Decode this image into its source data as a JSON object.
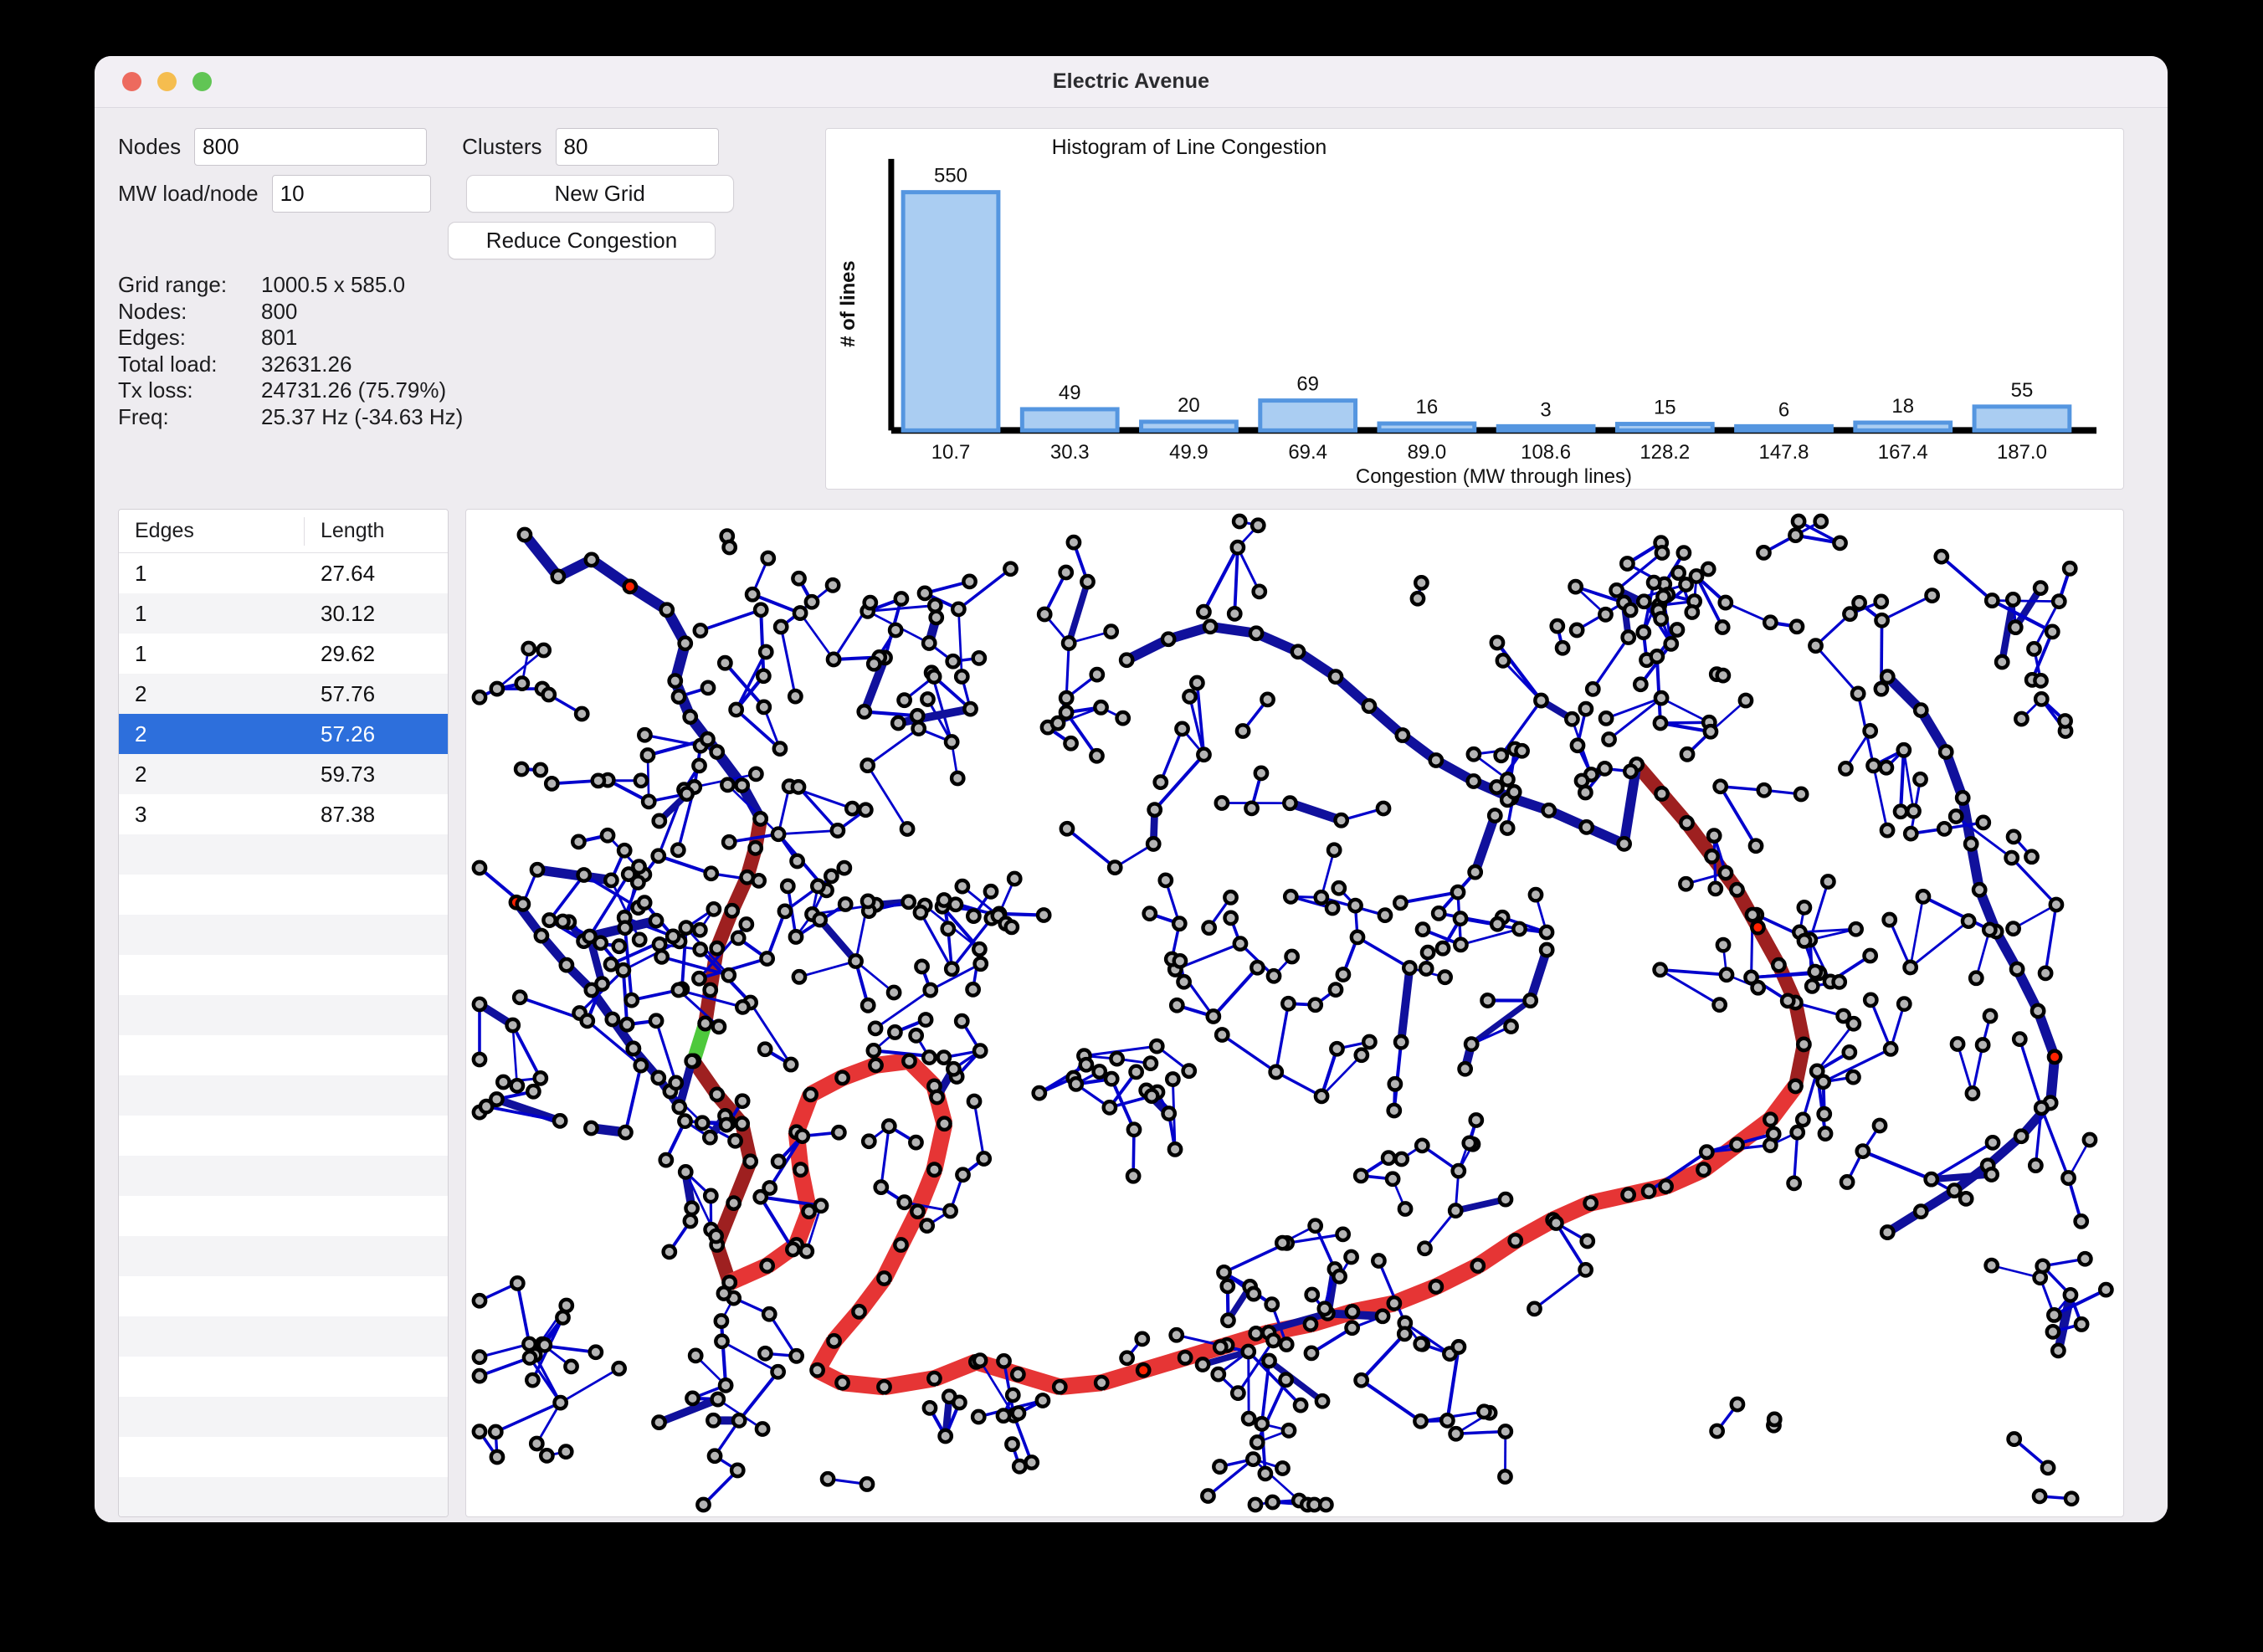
{
  "window": {
    "title": "Electric Avenue",
    "traffic_lights": [
      {
        "name": "close-button",
        "color": "#ed6a5e"
      },
      {
        "name": "minimize-button",
        "color": "#f5bd4f"
      },
      {
        "name": "zoom-button",
        "color": "#61c554"
      }
    ]
  },
  "controls": {
    "nodes_label": "Nodes",
    "nodes_value": "800",
    "clusters_label": "Clusters",
    "clusters_value": "80",
    "mwload_label": "MW load/node",
    "mwload_value": "10",
    "new_grid_label": "New Grid",
    "reduce_congestion_label": "Reduce Congestion"
  },
  "stats": [
    {
      "key": "Grid range:",
      "value": "1000.5 x 585.0"
    },
    {
      "key": "Nodes:",
      "value": "800"
    },
    {
      "key": "Edges:",
      "value": "801"
    },
    {
      "key": "Total load:",
      "value": "32631.26"
    },
    {
      "key": "Tx loss:",
      "value": "24731.26 (75.79%)"
    },
    {
      "key": "Freq:",
      "value": "25.37 Hz (-34.63 Hz)"
    }
  ],
  "table": {
    "columns": [
      "Edges",
      "Length"
    ],
    "rows": [
      {
        "edges": "1",
        "length": "27.64",
        "selected": false
      },
      {
        "edges": "1",
        "length": "30.12",
        "selected": false
      },
      {
        "edges": "1",
        "length": "29.62",
        "selected": false
      },
      {
        "edges": "2",
        "length": "57.76",
        "selected": false
      },
      {
        "edges": "2",
        "length": "57.26",
        "selected": true
      },
      {
        "edges": "2",
        "length": "59.73",
        "selected": false
      },
      {
        "edges": "3",
        "length": "87.38",
        "selected": false
      }
    ],
    "empty_row_count": 17,
    "selection_color": "#2d6fdc"
  },
  "chart_data": {
    "type": "bar",
    "title": "Histogram of Line Congestion",
    "xlabel": "Congestion (MW through lines)",
    "ylabel": "# of lines",
    "categories": [
      "10.7",
      "30.3",
      "49.9",
      "69.4",
      "89.0",
      "108.6",
      "128.2",
      "147.8",
      "167.4",
      "187.0"
    ],
    "values": [
      550,
      49,
      20,
      69,
      16,
      3,
      15,
      6,
      18,
      55
    ],
    "ylim": [
      0,
      550
    ],
    "grid": false,
    "legend": null,
    "bar_fill": "#aacdf2",
    "bar_stroke": "#5596e0"
  },
  "graph": {
    "node_fill": "#b4b4b4",
    "node_stroke": "#000000",
    "edge_colors": {
      "normal": "#0000cc",
      "heavy": "#10109c",
      "dark_red": "#9e2020",
      "bright_red": "#e63535",
      "green": "#4ec93c",
      "hot_node": "#ff2200"
    }
  }
}
